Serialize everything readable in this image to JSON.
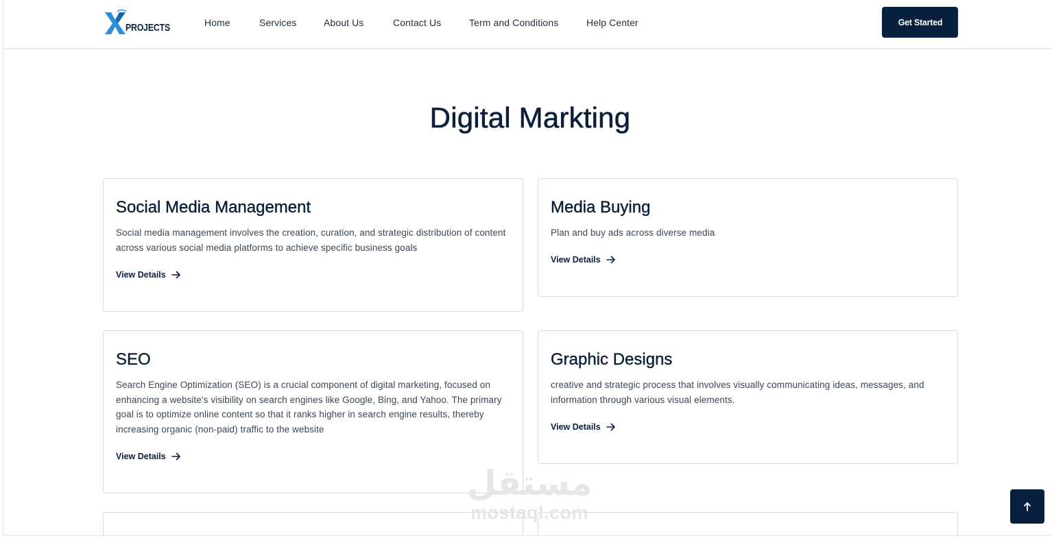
{
  "header": {
    "logo_text": "PROJECTS",
    "logo_alt": "X PROJECTS",
    "nav": [
      "Home",
      "Services",
      "About Us",
      "Contact Us",
      "Term and Conditions",
      "Help Center"
    ],
    "cta_label": "Get Started"
  },
  "page_title": "Digital Markting",
  "cards": [
    {
      "title": "Social Media Management",
      "description": "Social media management involves the creation, curation, and strategic distribution of content across various social media platforms to achieve specific business goals",
      "link_label": "View Details"
    },
    {
      "title": "Media Buying",
      "description": "Plan and buy ads across diverse media",
      "link_label": "View Details"
    },
    {
      "title": "SEO",
      "description": "Search Engine Optimization (SEO) is a crucial component of digital marketing, focused on enhancing a website's visibility on search engines like Google, Bing, and Yahoo. The primary goal is to optimize online content so that it ranks higher in search engine results, thereby increasing organic (non-paid) traffic to the website",
      "link_label": "View Details"
    },
    {
      "title": "Graphic Designs",
      "description": "creative and strategic process that involves visually communicating ideas, messages, and information through various visual elements.",
      "link_label": "View Details"
    }
  ],
  "watermark": {
    "arabic": "مستقل",
    "latin": "mostaql.com"
  },
  "icons": {
    "details": "arrow-right-icon",
    "to_top": "arrow-up-icon"
  },
  "colors": {
    "brand_navy": "#07203d",
    "text": "#0b1f3a",
    "logo_blue": "#2a8fd8"
  }
}
